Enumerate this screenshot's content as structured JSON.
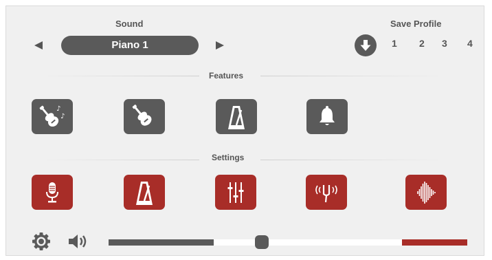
{
  "sound": {
    "label": "Sound",
    "value": "Piano 1",
    "prev_icon": "triangle-left-icon",
    "next_icon": "triangle-right-icon"
  },
  "save_profile": {
    "label": "Save Profile",
    "download_icon": "download-arrow-icon",
    "profiles": [
      "1",
      "2",
      "3",
      "4"
    ]
  },
  "features": {
    "title": "Features",
    "items": [
      {
        "icon": "violin-with-notes-icon"
      },
      {
        "icon": "violin-icon"
      },
      {
        "icon": "metronome-icon"
      },
      {
        "icon": "bell-icon"
      }
    ]
  },
  "settings": {
    "title": "Settings",
    "items": [
      {
        "icon": "microphone-icon"
      },
      {
        "icon": "metronome-icon"
      },
      {
        "icon": "equalizer-sliders-icon"
      },
      {
        "icon": "tuning-fork-icon"
      },
      {
        "icon": "sound-wave-icon"
      }
    ]
  },
  "bottom_bar": {
    "settings_icon": "gear-icon",
    "volume_icon": "speaker-volume-icon",
    "slider_value_fraction": 0.43,
    "range_start_fraction": 0.3,
    "range_end_fraction": 0.82
  },
  "colors": {
    "panel": "#f0f0f0",
    "dark_gray": "#5a5a5a",
    "red": "#a82d28",
    "text": "#555555"
  }
}
